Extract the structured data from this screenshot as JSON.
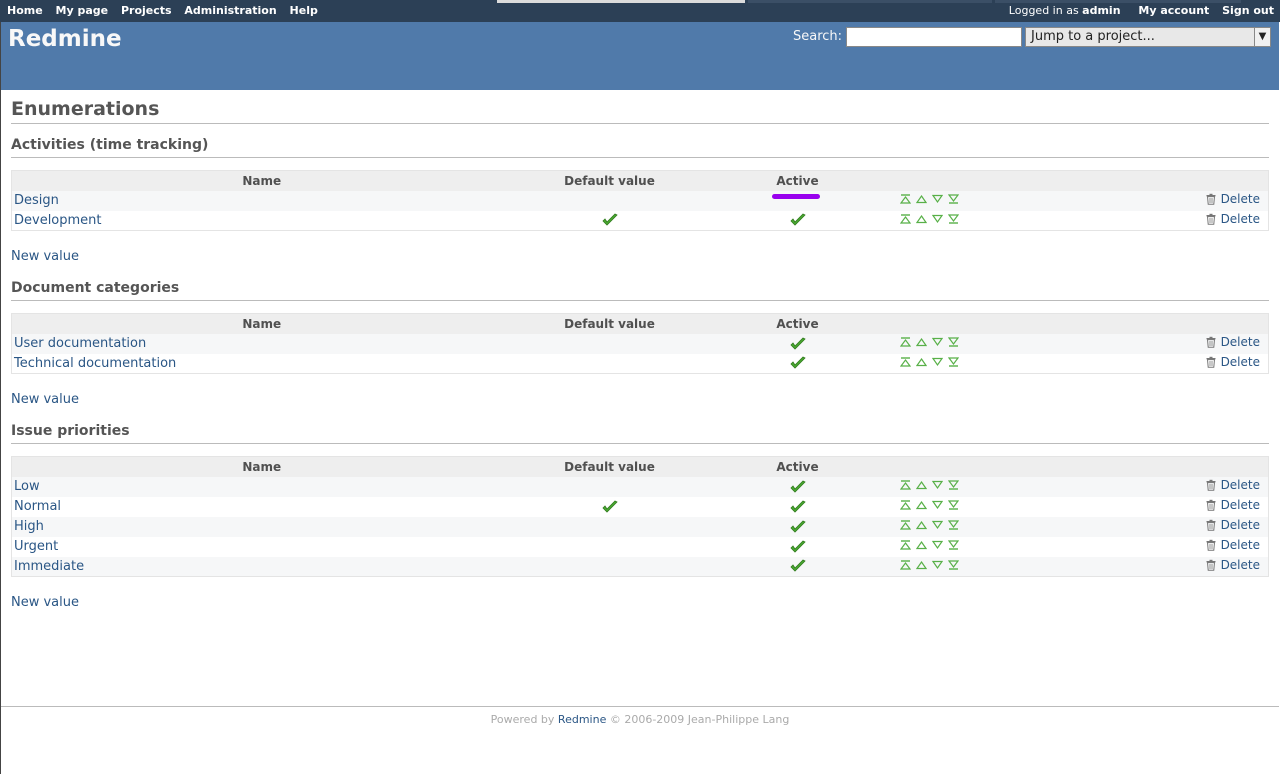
{
  "top_menu": {
    "items": [
      "Home",
      "My page",
      "Projects",
      "Administration",
      "Help"
    ],
    "logged_as_prefix": "Logged in as",
    "user": "admin",
    "my_account": "My account",
    "sign_out": "Sign out"
  },
  "header": {
    "title": "Redmine",
    "search_label": "Search:",
    "search_value": "",
    "jump_label": "Jump to a project..."
  },
  "page_title": "Enumerations",
  "columns": {
    "name": "Name",
    "default": "Default value",
    "active": "Active"
  },
  "delete_label": "Delete",
  "new_value_label": "New value",
  "sections": [
    {
      "title": "Activities (time tracking)",
      "rows": [
        {
          "name": "Design",
          "default": false,
          "active": false
        },
        {
          "name": "Development",
          "default": true,
          "active": true
        }
      ]
    },
    {
      "title": "Document categories",
      "rows": [
        {
          "name": "User documentation",
          "default": false,
          "active": true
        },
        {
          "name": "Technical documentation",
          "default": false,
          "active": true
        }
      ]
    },
    {
      "title": "Issue priorities",
      "rows": [
        {
          "name": "Low",
          "default": false,
          "active": true
        },
        {
          "name": "Normal",
          "default": true,
          "active": true
        },
        {
          "name": "High",
          "default": false,
          "active": true
        },
        {
          "name": "Urgent",
          "default": false,
          "active": true
        },
        {
          "name": "Immediate",
          "default": false,
          "active": true
        }
      ]
    }
  ],
  "colors": {
    "header_bg": "#507AAA",
    "top_menu_bg": "#2C4056",
    "check": "#3a9c2a",
    "highlight": "#9900ee"
  },
  "footer": {
    "prefix": "Powered by",
    "link": "Redmine",
    "suffix": "© 2006-2009 Jean-Philippe Lang"
  }
}
